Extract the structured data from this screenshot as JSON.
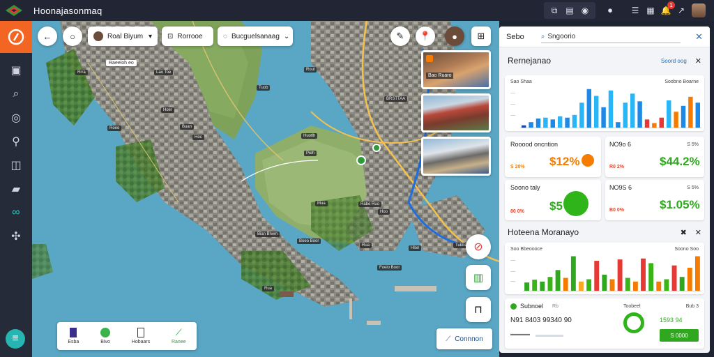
{
  "app": {
    "title": "Hoonajasonmaq",
    "notification_count": "1"
  },
  "map_toolbar": {
    "location_select_label": "Roal Biyum",
    "filter_label": "Rorrooe",
    "category_select_label": "Bucguelsanaag"
  },
  "map_labels": {
    "top_label": "Raeeloh eo",
    "tags": [
      "Rrra",
      "Lao Toe",
      "Hoer",
      "Roeo",
      "Buan",
      "Hoc",
      "Tuob",
      "Roul",
      "BRSTTAA",
      "Huotlh",
      "Pieh",
      "Rabe Ruo",
      "Mua",
      "Bian Brwm",
      "Boeo Boor",
      "Rua",
      "Hlon",
      "Foeio Boor",
      "Hoo",
      "Tubbab",
      "Rua"
    ]
  },
  "photos": [
    {
      "label": "Bao Ruaro"
    },
    {
      "label": ""
    },
    {
      "label": ""
    }
  ],
  "legend": [
    {
      "label": "Esba",
      "color": "#3a2e8c"
    },
    {
      "label": "Bivo",
      "color": "#3bb34a"
    },
    {
      "label": "Hobaars",
      "color": "#333333"
    },
    {
      "label": "Ranee",
      "color": "#2f9a3a"
    }
  ],
  "connect_button": {
    "label": "Connnon"
  },
  "panel": {
    "header_label": "Sebo",
    "search_value": "Sngoorio",
    "section1": {
      "title": "Rernejanao",
      "link": "Soord oog"
    },
    "card1": {
      "label_left": "Sao Shaa",
      "label_right": "Soobno Boarne"
    },
    "kpi1": {
      "title": "Rooood oncntion",
      "value": "$12%",
      "sub": "S 20%"
    },
    "kpi2": {
      "title": "NO9o 6",
      "value": "$44.2%",
      "sub1": "R0 2%",
      "sub2": "S 5%"
    },
    "kpi3": {
      "title": "Soono taly",
      "value": "$5",
      "sub": "80 0%"
    },
    "kpi4": {
      "title": "NO9S 6",
      "value": "$1.05%",
      "sub1": "B0 0%",
      "sub2": "S 5%"
    },
    "section2": {
      "title": "Hoteena Moranayo"
    },
    "card2": {
      "label_left": "Soo Bbeoooce",
      "label_right": "Soono Soo"
    },
    "card3": {
      "title": "Subnoel",
      "title_suffix": "Rb",
      "id_text": "N91 8403 99340 90",
      "right_label": "Toobeel",
      "right_badge": "Bub 3",
      "stat": "1593 94",
      "green_button": "S 0000"
    }
  },
  "chart_data": [
    {
      "type": "bar",
      "values": [
        5,
        12,
        20,
        22,
        18,
        25,
        22,
        28,
        55,
        85,
        70,
        45,
        82,
        12,
        55,
        75,
        58,
        18,
        10,
        22,
        60,
        35,
        48,
        68,
        55
      ],
      "colors": [
        "#1e44b0",
        "#1e88e5",
        "#1e88e5",
        "#29b6f6",
        "#1e88e5",
        "#29b6f6",
        "#1e88e5",
        "#29b6f6",
        "#29b6f6",
        "#1e88e5",
        "#29b6f6",
        "#1e88e5",
        "#29b6f6",
        "#1e88e5",
        "#29b6f6",
        "#29b6f6",
        "#1e88e5",
        "#e53935",
        "#f57c00",
        "#e53935",
        "#29b6f6",
        "#f57c00",
        "#1e88e5",
        "#f57c00",
        "#1e88e5"
      ]
    },
    {
      "type": "bar",
      "values": [
        18,
        24,
        20,
        30,
        45,
        28,
        75,
        20,
        25,
        65,
        35,
        25,
        68,
        28,
        20,
        70,
        60,
        20,
        25,
        55,
        30,
        50,
        75
      ],
      "colors": [
        "#2fa81f",
        "#39b518",
        "#2fa81f",
        "#39b518",
        "#2fa81f",
        "#f57c00",
        "#2fa81f",
        "#f9a825",
        "#39b518",
        "#e53935",
        "#2fa81f",
        "#f57c00",
        "#e53935",
        "#39b518",
        "#f57c00",
        "#e53935",
        "#39b518",
        "#f57c00",
        "#39b518",
        "#e53935",
        "#2fa81f",
        "#f57c00",
        "#f57c00"
      ]
    }
  ]
}
